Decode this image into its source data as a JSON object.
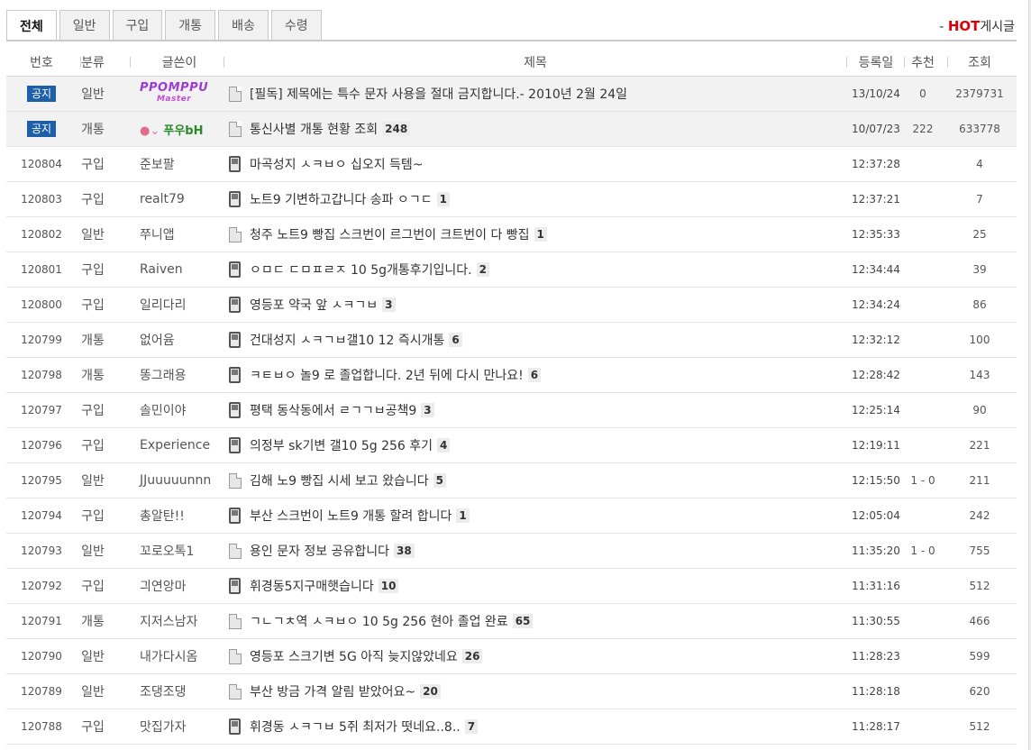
{
  "tabs": [
    {
      "label": "전체",
      "active": true
    },
    {
      "label": "일반",
      "active": false
    },
    {
      "label": "구입",
      "active": false
    },
    {
      "label": "개통",
      "active": false
    },
    {
      "label": "배송",
      "active": false
    },
    {
      "label": "수령",
      "active": false
    }
  ],
  "hot": {
    "prefix": "- ",
    "hot": "HOT",
    "suffix": "게시글"
  },
  "headers": {
    "no": "번호",
    "category": "분류",
    "author": "글쓴이",
    "title": "제목",
    "date": "등록일",
    "recommend": "추천",
    "views": "조회"
  },
  "notices": [
    {
      "badge": "공지",
      "category": "일반",
      "author_logo": {
        "main": "PPOMPPU",
        "sub": "Master"
      },
      "title": "[필독] 제목에는 특수 문자 사용을 절대 금지합니다.- 2010년 2월 24일",
      "comments": "",
      "date": "13/10/24",
      "recommend": "0",
      "views": "2379731"
    },
    {
      "badge": "공지",
      "category": "개통",
      "author_nick": "푸우bH",
      "title": "통신사별 개통 현황 조회",
      "comments": "248",
      "date": "10/07/23",
      "recommend": "222",
      "views": "633778"
    }
  ],
  "posts": [
    {
      "no": "120804",
      "category": "구입",
      "author": "준보팔",
      "icon": "phone",
      "title": "마곡성지 ㅅㅋㅂㅇ 십오지 득템~",
      "comments": "",
      "date": "12:37:28",
      "recommend": "",
      "views": "4"
    },
    {
      "no": "120803",
      "category": "구입",
      "author": "realt79",
      "icon": "phone",
      "title": "노트9 기변하고갑니다 송파 ㅇㄱㄷ",
      "comments": "1",
      "date": "12:37:21",
      "recommend": "",
      "views": "7"
    },
    {
      "no": "120802",
      "category": "일반",
      "author": "쭈니앱",
      "icon": "doc",
      "title": "청주 노트9 빵집 스크번이 르그번이 크트번이 다 빵집",
      "comments": "1",
      "date": "12:35:33",
      "recommend": "",
      "views": "25"
    },
    {
      "no": "120801",
      "category": "구입",
      "author": "Raiven",
      "icon": "phone",
      "title": "ㅇㅁㄷ ㄷㅁㅍㄹㅈ 10 5g개통후기입니다.",
      "comments": "2",
      "date": "12:34:44",
      "recommend": "",
      "views": "39"
    },
    {
      "no": "120800",
      "category": "구입",
      "author": "일리다리",
      "icon": "phone",
      "title": "영등포 약국 앞 ㅅㅋㄱㅂ",
      "comments": "3",
      "date": "12:34:24",
      "recommend": "",
      "views": "86"
    },
    {
      "no": "120799",
      "category": "개통",
      "author": "없어윰",
      "icon": "phone",
      "title": "건대성지 ㅅㅋㄱㅂ갤10 12 즉시개통",
      "comments": "6",
      "date": "12:32:12",
      "recommend": "",
      "views": "100"
    },
    {
      "no": "120798",
      "category": "개통",
      "author": "똥그래용",
      "icon": "phone",
      "title": "ㅋㅌㅂㅇ 놀9 로 졸업합니다. 2년 뒤에 다시 만나요!",
      "comments": "6",
      "date": "12:28:42",
      "recommend": "",
      "views": "143"
    },
    {
      "no": "120797",
      "category": "구입",
      "author": "솔민이야",
      "icon": "phone",
      "title": "평택 동삭동에서 ㄹㄱㄱㅂ공책9",
      "comments": "3",
      "date": "12:25:14",
      "recommend": "",
      "views": "90"
    },
    {
      "no": "120796",
      "category": "구입",
      "author": "Experience",
      "icon": "phone",
      "title": "의정부 sk기변 갤10 5g 256 후기",
      "comments": "4",
      "date": "12:19:11",
      "recommend": "",
      "views": "221"
    },
    {
      "no": "120795",
      "category": "일반",
      "author": "JJuuuuunnn",
      "icon": "doc",
      "title": "김해 노9 빵집 시세 보고 왔습니다",
      "comments": "5",
      "date": "12:15:50",
      "recommend": "1 - 0",
      "views": "211"
    },
    {
      "no": "120794",
      "category": "구입",
      "author": "총알탄!!",
      "icon": "phone",
      "title": "부산 스크번이 노트9 개통 할려 합니다",
      "comments": "1",
      "date": "12:05:04",
      "recommend": "",
      "views": "242"
    },
    {
      "no": "120793",
      "category": "일반",
      "author": "꼬로오톡1",
      "icon": "doc",
      "title": "용인 문자 정보 공유합니다",
      "comments": "38",
      "date": "11:35:20",
      "recommend": "1 - 0",
      "views": "755"
    },
    {
      "no": "120792",
      "category": "구입",
      "author": "긔연앙마",
      "icon": "phone",
      "title": "휘경동5지구매햇습니다",
      "comments": "10",
      "date": "11:31:16",
      "recommend": "",
      "views": "512"
    },
    {
      "no": "120791",
      "category": "개통",
      "author": "지저스남자",
      "icon": "doc",
      "title": "ㄱㄴㄱㅊ역 ㅅㅋㅂㅇ 10 5g 256 현아 졸업 완료",
      "comments": "65",
      "date": "11:30:55",
      "recommend": "",
      "views": "466"
    },
    {
      "no": "120790",
      "category": "일반",
      "author": "내가다시옴",
      "icon": "doc",
      "title": "영등포 스크기변 5G 아직 늦지않았네요",
      "comments": "26",
      "date": "11:28:23",
      "recommend": "",
      "views": "599"
    },
    {
      "no": "120789",
      "category": "일반",
      "author": "조댕조댕",
      "icon": "doc",
      "title": "부산 방금 가격 알림 받았어요~",
      "comments": "20",
      "date": "11:28:18",
      "recommend": "",
      "views": "620"
    },
    {
      "no": "120788",
      "category": "구입",
      "author": "맛집가자",
      "icon": "phone",
      "title": "휘경동 ㅅㅋㄱㅂ 5쥐 최저가 떳네요..8..",
      "comments": "7",
      "date": "11:28:17",
      "recommend": "",
      "views": "512"
    }
  ],
  "colors": {
    "badge": "#1f5fa8",
    "hot": "#e0000a",
    "notice_bg": "#f2f2f2"
  }
}
